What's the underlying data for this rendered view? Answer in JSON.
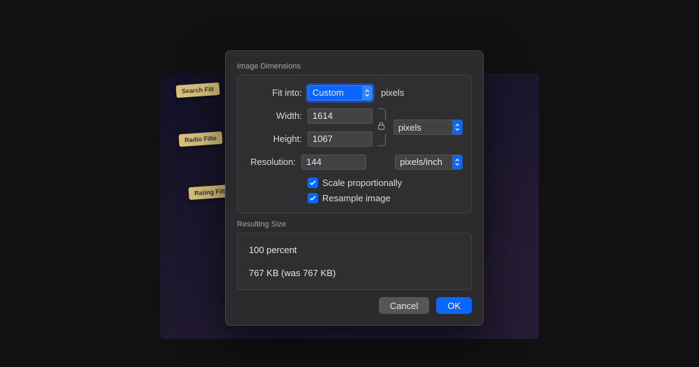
{
  "bg_tags": [
    "Search Filt",
    "Radio Filte",
    "Rating Filt"
  ],
  "dialog": {
    "section1": "Image Dimensions",
    "fit_label": "Fit into:",
    "fit_value": "Custom",
    "fit_suffix": "pixels",
    "width_label": "Width:",
    "width_value": "1614",
    "height_label": "Height:",
    "height_value": "1067",
    "wh_unit": "pixels",
    "res_label": "Resolution:",
    "res_value": "144",
    "res_unit": "pixels/inch",
    "scale_prop": "Scale proportionally",
    "resample": "Resample image",
    "section2": "Resulting Size",
    "percent": "100 percent",
    "filesize": "767 KB (was 767 KB)",
    "cancel": "Cancel",
    "ok": "OK"
  }
}
